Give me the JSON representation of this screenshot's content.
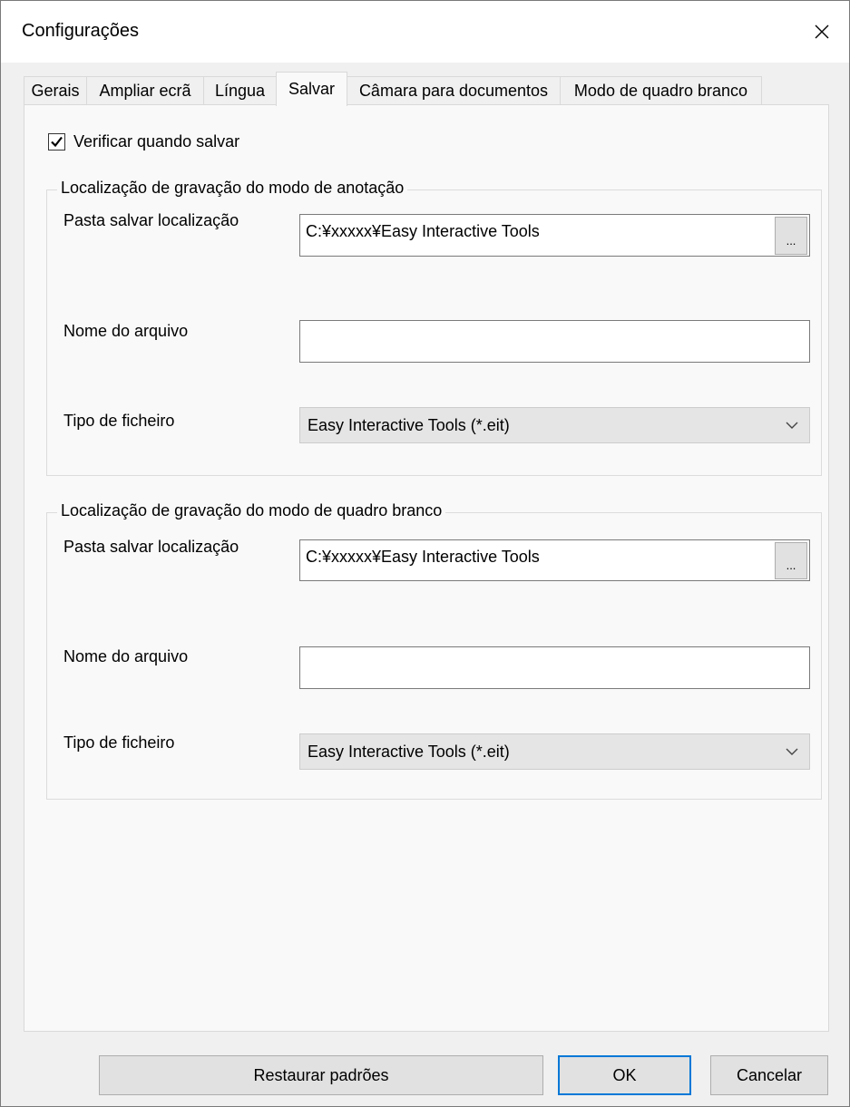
{
  "window": {
    "title": "Configurações"
  },
  "tabs": [
    {
      "label": "Gerais"
    },
    {
      "label": "Ampliar ecrã"
    },
    {
      "label": "Língua"
    },
    {
      "label": "Salvar"
    },
    {
      "label": "Câmara para documentos"
    },
    {
      "label": "Modo de quadro branco"
    }
  ],
  "active_tab": "Salvar",
  "verify_on_save": {
    "label": "Verificar quando salvar",
    "checked": true
  },
  "annotation_group": {
    "legend": "Localização de gravação do modo de anotação",
    "folder_label": "Pasta salvar localização",
    "folder_value": "C:¥xxxxx¥Easy Interactive Tools",
    "browse_label": "...",
    "filename_label": "Nome do arquivo",
    "filename_value": "",
    "filetype_label": "Tipo de ficheiro",
    "filetype_value": "Easy Interactive Tools (*.eit)"
  },
  "whiteboard_group": {
    "legend": "Localização de gravação do modo de quadro branco",
    "folder_label": "Pasta salvar localização",
    "folder_value": "C:¥xxxxx¥Easy Interactive Tools",
    "browse_label": "...",
    "filename_label": "Nome do arquivo",
    "filename_value": "",
    "filetype_label": "Tipo de ficheiro",
    "filetype_value": "Easy Interactive Tools (*.eit)"
  },
  "buttons": {
    "restore": "Restaurar padrões",
    "ok": "OK",
    "cancel": "Cancelar"
  },
  "icons": {
    "close": "close-icon",
    "check": "check-icon",
    "dropdown": "chevron-down-icon"
  }
}
